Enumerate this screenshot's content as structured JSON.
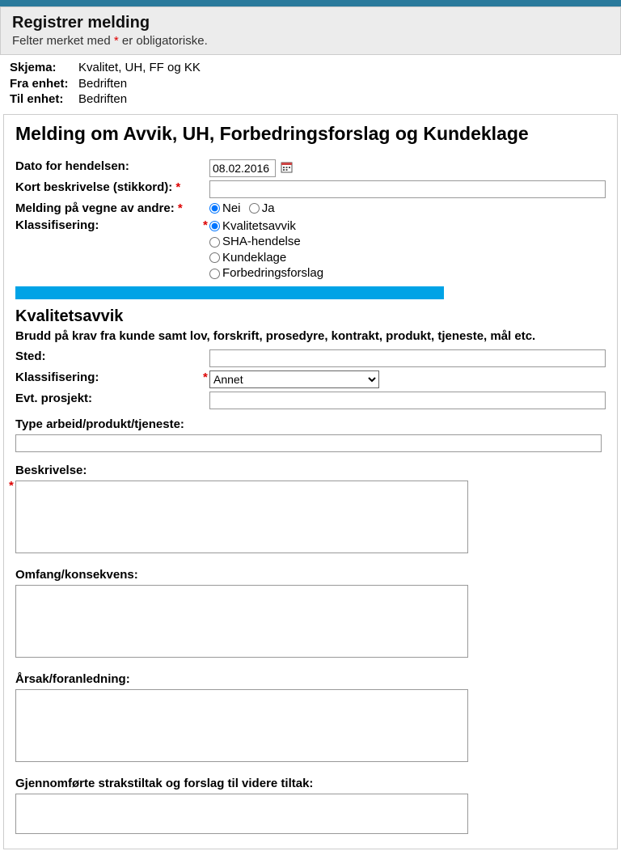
{
  "header": {
    "title": "Registrer melding",
    "subtitle_pre": "Felter merket med ",
    "subtitle_star": "*",
    "subtitle_post": " er obligatoriske."
  },
  "meta": {
    "schema_label": "Skjema:",
    "schema_value": "Kvalitet, UH, FF og KK",
    "from_label": "Fra enhet:",
    "from_value": "Bedriften",
    "to_label": "Til enhet:",
    "to_value": "Bedriften"
  },
  "form": {
    "title": "Melding om Avvik, UH, Forbedringsforslag og Kundeklage",
    "date_label": "Dato for hendelsen:",
    "date_value": "08.02.2016",
    "short_desc_label": "Kort beskrivelse (stikkord):",
    "on_behalf_label": "Melding på vegne av andre:",
    "on_behalf_no": "Nei",
    "on_behalf_yes": "Ja",
    "classification_label": "Klassifisering:",
    "class_options": {
      "kvalitetsavvik": "Kvalitetsavvik",
      "sha": "SHA-hendelse",
      "kundeklage": "Kundeklage",
      "forbedring": "Forbedringsforslag"
    }
  },
  "section": {
    "title": "Kvalitetsavvik",
    "desc": "Brudd på krav fra kunde samt lov, forskrift, prosedyre, kontrakt, produkt, tjeneste, mål etc.",
    "sted_label": "Sted:",
    "klass_label": "Klassifisering:",
    "klass_value": "Annet",
    "prosjekt_label": "Evt. prosjekt:",
    "type_arbeid_label": "Type arbeid/produkt/tjeneste:",
    "beskrivelse_label": "Beskrivelse:",
    "omfang_label": "Omfang/konsekvens:",
    "arsak_label": "Årsak/foranledning:",
    "strakstiltak_label": "Gjennomførte strakstiltak og forslag til videre tiltak:"
  }
}
